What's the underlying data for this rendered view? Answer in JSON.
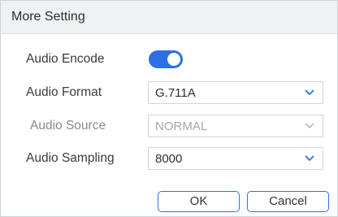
{
  "dialog": {
    "title": "More Setting"
  },
  "fields": {
    "audio_encode": {
      "label": "Audio Encode",
      "enabled": true
    },
    "audio_format": {
      "label": "Audio Format",
      "value": "G.711A"
    },
    "audio_source": {
      "label": "Audio Source",
      "value": "NORMAL",
      "disabled": true
    },
    "audio_sampling": {
      "label": "Audio Sampling",
      "value": "8000"
    }
  },
  "buttons": {
    "ok": "OK",
    "cancel": "Cancel"
  },
  "colors": {
    "accent": "#2f6fe4",
    "chevron_active": "#2f6fe4",
    "chevron_disabled": "#b8b8b8"
  },
  "icons": {
    "dropdown": "chevron-down-icon"
  }
}
